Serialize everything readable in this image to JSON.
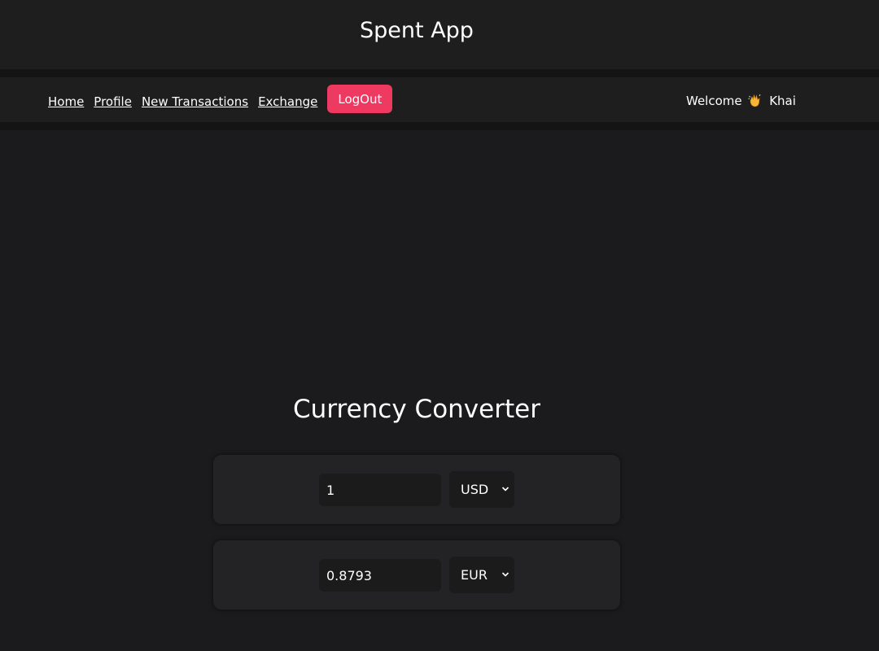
{
  "header": {
    "title": "Spent App"
  },
  "nav": {
    "links": [
      {
        "label": "Home"
      },
      {
        "label": "Profile"
      },
      {
        "label": "New Transactions"
      },
      {
        "label": "Exchange"
      }
    ],
    "logout_label": "LogOut",
    "logout_color": "#ee3a60",
    "welcome_prefix": "Welcome",
    "welcome_icon": "waving-hand-icon",
    "user_name": "Khai"
  },
  "converter": {
    "title": "Currency Converter",
    "from": {
      "amount": "1",
      "currency": "USD"
    },
    "to": {
      "amount": "0.8793",
      "currency": "EUR"
    }
  }
}
